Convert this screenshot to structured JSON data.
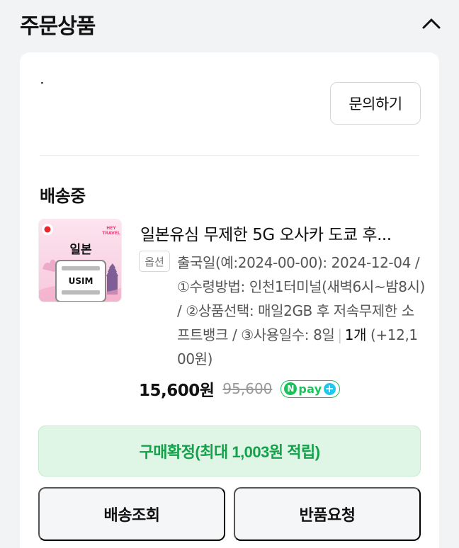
{
  "section": {
    "title": "주문상품"
  },
  "seller": {
    "inquiry_label": "문의하기"
  },
  "order": {
    "status": "배송중",
    "product": {
      "name": "일본유심 무제한 5G 오사카 도쿄 후...",
      "thumbnail": {
        "brand": "HEY TRAVEL",
        "country_label": "일본",
        "chip_label": "USIM"
      },
      "option_label": "옵션",
      "option_text": "출국일(예:2024-00-00): 2024-12-04 / ①수령방법: 인천1터미널(새벽6시~밤8시) / ②상품선택: 매일2GB 후 저속무제한 소프트뱅크 / ③사용일수: 8일",
      "option_separator": "|",
      "quantity": "1개",
      "extra_price": "(+12,100원)",
      "price": "15,600원",
      "original_price": "95,600",
      "payment_badge": {
        "n_letter": "N",
        "text": "pay",
        "plus": "+"
      }
    }
  },
  "actions": {
    "confirm_label": "구매확정(최대 1,003원 적립)",
    "track_label": "배송조회",
    "return_label": "반품요청"
  },
  "colors": {
    "accent_green": "#13a14a",
    "confirm_bg": "#dff5e5",
    "npay_green": "#19c35a",
    "npay_blue": "#1ec8f0"
  }
}
